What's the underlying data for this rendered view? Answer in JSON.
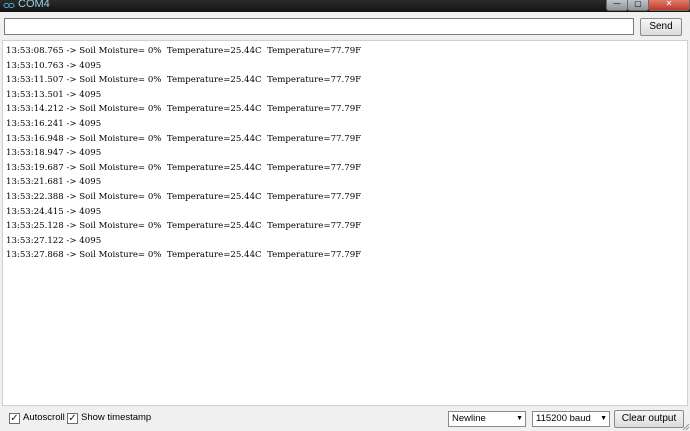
{
  "window": {
    "title": "COM4",
    "minimize_glyph": "—",
    "maximize_glyph": "▢",
    "close_glyph": "✕"
  },
  "icons": {
    "app": "arduino-logo-icon",
    "checkbox": "checkmark-icon",
    "dropdown": "chevron-down-icon"
  },
  "send": {
    "input_value": "",
    "button_label": "Send"
  },
  "output": {
    "lines": [
      "13:53:08.765 -> Soil Moisture= 0%  Temperature=25.44C  Temperature=77.79F",
      "13:53:10.763 -> 4095",
      "13:53:11.507 -> Soil Moisture= 0%  Temperature=25.44C  Temperature=77.79F",
      "13:53:13.501 -> 4095",
      "13:53:14.212 -> Soil Moisture= 0%  Temperature=25.44C  Temperature=77.79F",
      "13:53:16.241 -> 4095",
      "13:53:16.948 -> Soil Moisture= 0%  Temperature=25.44C  Temperature=77.79F",
      "13:53:18.947 -> 4095",
      "13:53:19.687 -> Soil Moisture= 0%  Temperature=25.44C  Temperature=77.79F",
      "13:53:21.681 -> 4095",
      "13:53:22.388 -> Soil Moisture= 0%  Temperature=25.44C  Temperature=77.79F",
      "13:53:24.415 -> 4095",
      "13:53:25.128 -> Soil Moisture= 0%  Temperature=25.44C  Temperature=77.79F",
      "13:53:27.122 -> 4095",
      "13:53:27.868 -> Soil Moisture= 0%  Temperature=25.44C  Temperature=77.79F"
    ]
  },
  "footer": {
    "autoscroll": {
      "label": "Autoscroll",
      "checked": true,
      "mark": "✓"
    },
    "timestamp": {
      "label": "Show timestamp",
      "checked": true,
      "mark": "✓"
    },
    "line_ending": {
      "value": "Newline"
    },
    "baud": {
      "value": "115200 baud"
    },
    "clear_label": "Clear output"
  },
  "colors": {
    "titlebar": "#1a1a1a",
    "title_text": "#9bd1e8",
    "close_button": "#c0392b"
  }
}
